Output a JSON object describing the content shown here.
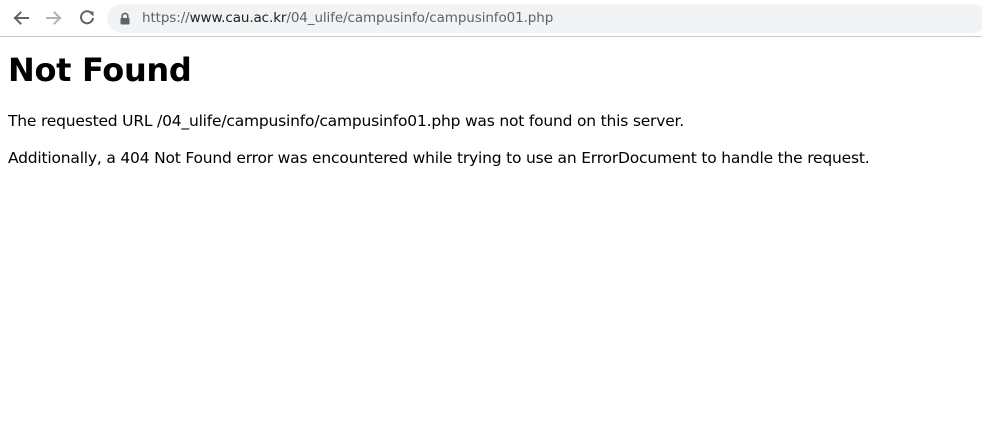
{
  "browser": {
    "back_icon": "arrow-left-icon",
    "forward_icon": "arrow-right-icon",
    "reload_icon": "reload-icon",
    "lock_icon": "lock-icon",
    "url": {
      "scheme": "https://",
      "host": "www.cau.ac.kr",
      "path": "/04_ulife/campusinfo/campusinfo01.php"
    }
  },
  "page": {
    "title": "Not Found",
    "paragraph1": "The requested URL /04_ulife/campusinfo/campusinfo01.php was not found on this server.",
    "paragraph2": "Additionally, a 404 Not Found error was encountered while trying to use an ErrorDocument to handle the request."
  }
}
